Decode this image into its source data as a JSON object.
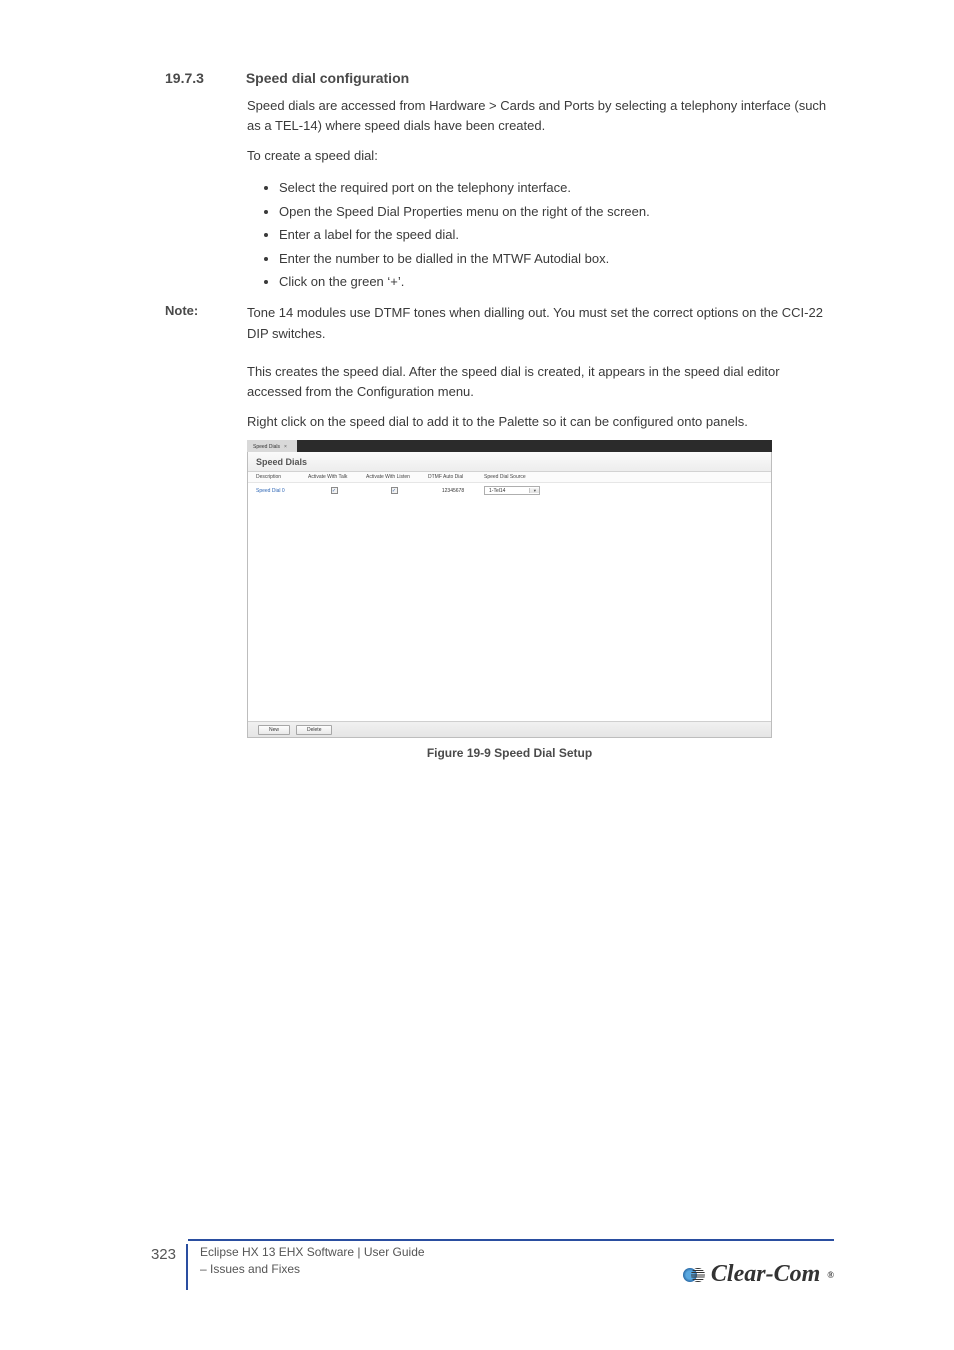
{
  "section": {
    "number": "19.7.3",
    "title": "Speed dial configuration"
  },
  "paragraphs": {
    "intro": "Speed dials are accessed from Hardware > Cards and Ports by selecting a telephony interface (such as a TEL-14) where speed dials have been created.",
    "tocreate": "To create a speed dial:",
    "steps": [
      "Select the required port on the telephony interface.",
      "Open the Speed Dial Properties menu on the right of the screen.",
      "Enter a label for the speed dial.",
      "Enter the number to be dialled in the MTWF Autodial box.",
      "Click on the green ‘+’."
    ],
    "note": "Tone 14 modules use DTMF tones when dialling out. You must set the correct options on the CCI-22 DIP switches.",
    "result": "This creates the speed dial. After the speed dial is created, it appears in the speed dial editor accessed from the Configuration menu.",
    "rightclick": "Right click on the speed dial to add it to the Palette so it can be configured onto panels."
  },
  "note_label": "Note:",
  "figure": {
    "tab": "Speed Dials",
    "panel_title": "Speed Dials",
    "columns": {
      "desc": "Description",
      "awt": "Activate With Talk",
      "awl": "Activate With Listen",
      "autodial": "DTMF Auto Dial",
      "source": "Speed Dial Source"
    },
    "row": {
      "desc": "Speed Dial 0",
      "awt_checked": "✓",
      "awl_checked": "✓",
      "autodial": "12345678",
      "source": "1-Tel14"
    },
    "buttons": {
      "new": "New",
      "delete": "Delete"
    }
  },
  "caption": "Figure 19-9 Speed Dial Setup",
  "footer": {
    "page": "323",
    "line1": "Eclipse HX 13 EHX Software | User Guide",
    "line2": "– Issues and Fixes"
  },
  "brand": "Clear-Com"
}
